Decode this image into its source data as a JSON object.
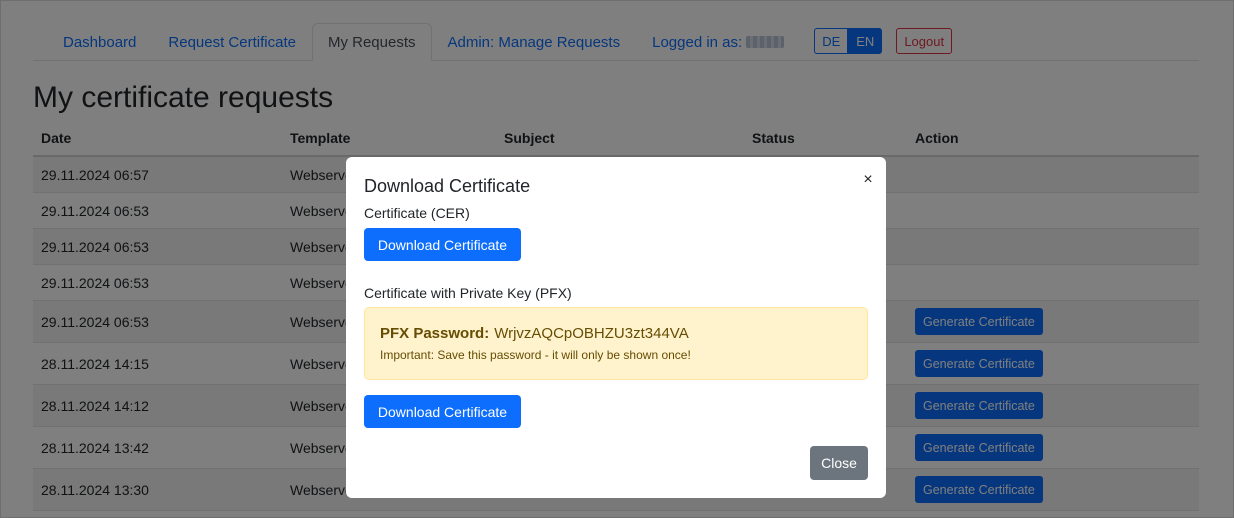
{
  "nav": {
    "items": [
      {
        "label": "Dashboard"
      },
      {
        "label": "Request Certificate"
      },
      {
        "label": "My Requests"
      },
      {
        "label": "Admin: Manage Requests"
      }
    ],
    "logged_in_label": "Logged in as:",
    "lang_de": "DE",
    "lang_en": "EN",
    "logout_label": "Logout"
  },
  "page": {
    "title": "My certificate requests"
  },
  "table": {
    "columns": [
      "Date",
      "Template",
      "Subject",
      "Status",
      "Action"
    ],
    "rows": [
      {
        "date": "29.11.2024 06:57",
        "template": "Webserve",
        "action": ""
      },
      {
        "date": "29.11.2024 06:53",
        "template": "Webserve",
        "action": ""
      },
      {
        "date": "29.11.2024 06:53",
        "template": "Webserve",
        "action": ""
      },
      {
        "date": "29.11.2024 06:53",
        "template": "Webserve",
        "action": ""
      },
      {
        "date": "29.11.2024 06:53",
        "template": "Webserve",
        "action": "Generate Certificate"
      },
      {
        "date": "28.11.2024 14:15",
        "template": "Webserve",
        "action": "Generate Certificate"
      },
      {
        "date": "28.11.2024 14:12",
        "template": "Webserve",
        "action": "Generate Certificate"
      },
      {
        "date": "28.11.2024 13:42",
        "template": "Webserve",
        "action": "Generate Certificate"
      },
      {
        "date": "28.11.2024 13:30",
        "template": "Webserve",
        "action": "Generate Certificate"
      }
    ]
  },
  "modal": {
    "title": "Download Certificate",
    "close_x": "×",
    "cer_label": "Certificate (CER)",
    "cer_button": "Download Certificate",
    "pfx_label": "Certificate with Private Key (PFX)",
    "pfx_password_label": "PFX Password:",
    "pfx_password": "WrjvzAQCpOBHZU3zt344VA",
    "pfx_note": "Important: Save this password - it will only be shown once!",
    "pfx_button": "Download Certificate",
    "close_button": "Close"
  },
  "colors": {
    "primary": "#0d6efd",
    "danger": "#dc3545",
    "secondary": "#6c757d",
    "warning_bg": "#fff3cd",
    "warning_text": "#664d03"
  }
}
